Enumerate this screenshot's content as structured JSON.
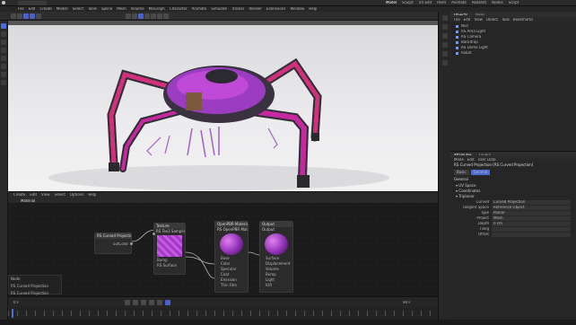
{
  "app": {
    "title": "",
    "top_tabs": [
      "Model",
      "Sculpt",
      "UV Edit",
      "Paint",
      "Animate",
      "Redshift",
      "Nodes",
      "Script"
    ]
  },
  "menu": [
    "File",
    "Edit",
    "Create",
    "Modes",
    "Select",
    "Tools",
    "Spline",
    "Mesh",
    "Volume",
    "MoGraph",
    "Character",
    "Animate",
    "Simulate",
    "Tracker",
    "Render",
    "Extensions",
    "Window",
    "Help"
  ],
  "object_manager": {
    "tabs": [
      "Objects",
      "Takes"
    ],
    "menu": [
      "File",
      "Edit",
      "View",
      "Object",
      "Tags",
      "Bookmarks"
    ],
    "items": [
      {
        "name": "Null"
      },
      {
        "name": "RS Area Light"
      },
      {
        "name": "RS Camera"
      },
      {
        "name": "Backdrop"
      },
      {
        "name": "RS Dome Light"
      },
      {
        "name": "Robot"
      }
    ]
  },
  "node_editor": {
    "menu": [
      "Create",
      "Edit",
      "View",
      "Select",
      "Options",
      "Help"
    ],
    "breadcrumb": "Material",
    "nodes": {
      "projection": {
        "title": "RS Curved Projection",
        "out": "outColor"
      },
      "texture": {
        "title": "Texture",
        "sub": "RS Tex3 Sampling",
        "in1": "Texture",
        "in2": "Bump",
        "in3": "RS Surface"
      },
      "material": {
        "title": "OpenPBR Material",
        "sub": "RS OpenPBR Material",
        "ports": [
          "Base",
          "Color",
          "Specular",
          "Coat",
          "Emission",
          "Thin Film"
        ]
      },
      "output": {
        "title": "Output",
        "sub": "Output",
        "ports": [
          "Surface",
          "Displacement",
          "Volume",
          "Bump",
          "Light",
          "IOR"
        ]
      }
    },
    "info_panel": {
      "line1": "Node",
      "line2": "RS Curved Projection",
      "line3": "RS Curved Projection"
    }
  },
  "attributes": {
    "tabs": [
      "Attributes",
      "Layers"
    ],
    "menu": [
      "Mode",
      "Edit",
      "User Data"
    ],
    "node_title": "RS Curved Projection [RS Curved Projection]",
    "subtabs": [
      "Basic",
      "General"
    ],
    "section": "General",
    "groups": [
      "UV Space",
      "Coordinates",
      "Triplanar"
    ],
    "fields": [
      {
        "label": "Curved",
        "value": "Curved Projection"
      },
      {
        "label": "Tangent Space",
        "value": "Reference Object"
      },
      {
        "label": "Type",
        "value": "Planar"
      },
      {
        "label": "Project",
        "value": "Mesh"
      },
      {
        "label": "Depth",
        "value": "0 cm"
      },
      {
        "label": "Tiling",
        "value": ""
      },
      {
        "label": "Offset",
        "value": ""
      }
    ]
  },
  "timeline": {
    "start": "0 F",
    "end": "90 F",
    "current": "0 F"
  },
  "colors": {
    "accent": "#4b6bd8",
    "node_pink": "#c040d8"
  }
}
